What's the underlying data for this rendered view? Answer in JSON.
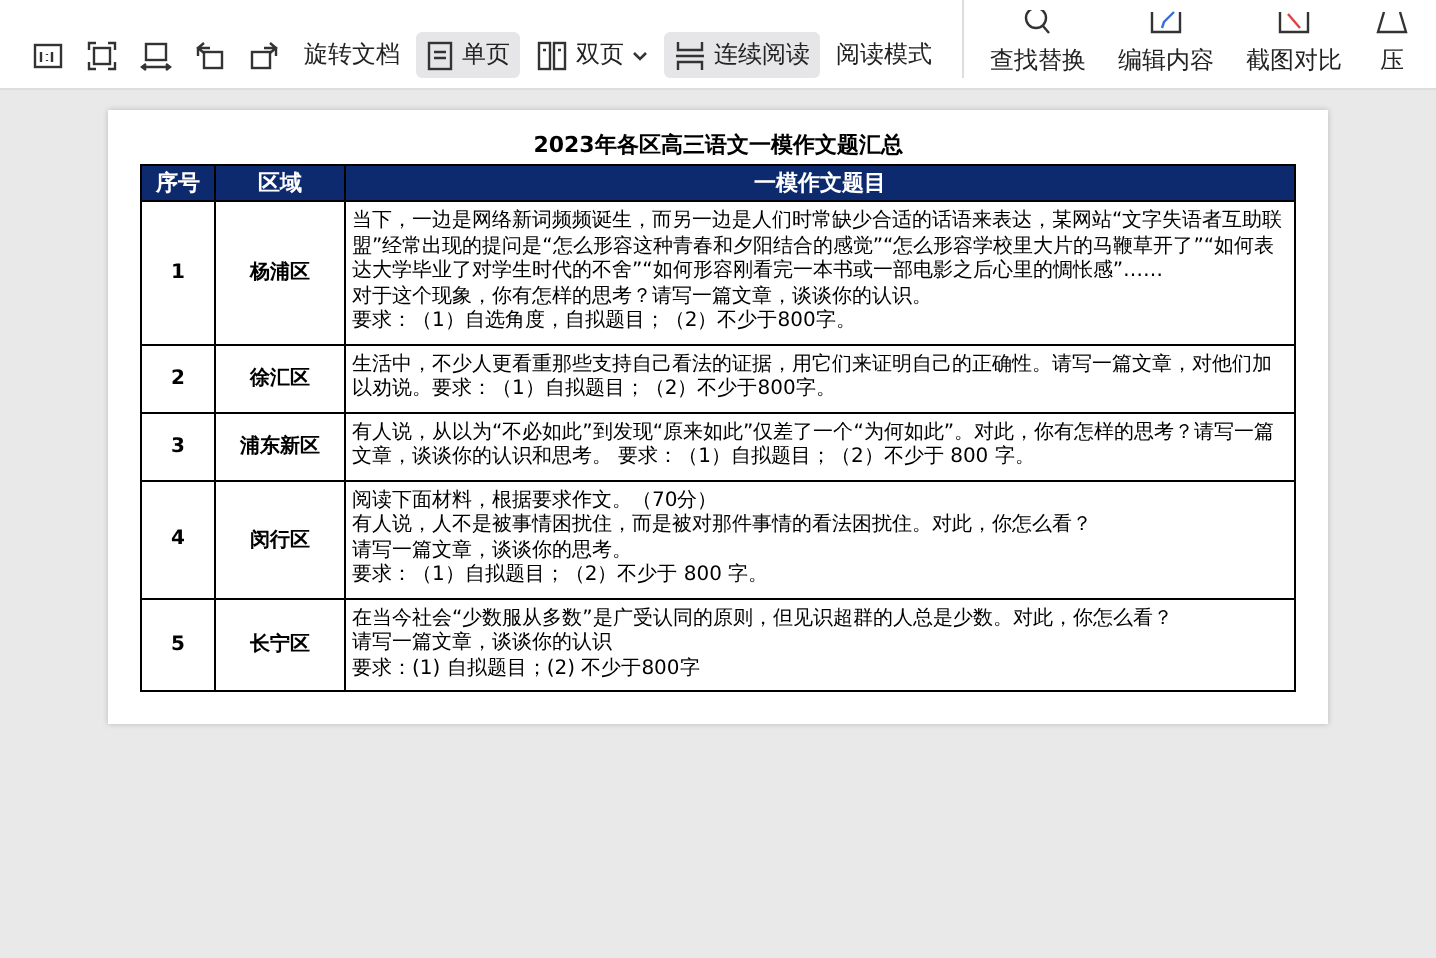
{
  "toolbar": {
    "view_buttons": [
      {
        "label": "旋转文档",
        "selected": false,
        "dropdown": false
      },
      {
        "label": "单页",
        "selected": true,
        "dropdown": false
      },
      {
        "label": "双页",
        "selected": false,
        "dropdown": true
      },
      {
        "label": "连续阅读",
        "selected": true,
        "dropdown": false
      },
      {
        "label": "阅读模式",
        "selected": false,
        "dropdown": false
      }
    ],
    "tools": [
      "查找替换",
      "编辑内容",
      "截图对比",
      "压"
    ]
  },
  "document": {
    "title": "2023年各区高三语文一模作文题汇总",
    "columns": [
      "序号",
      "区域",
      "一模作文题目"
    ],
    "rows": [
      {
        "number": "1",
        "district": "杨浦区",
        "prompt": [
          "当下，一边是网络新词频频诞生，而另一边是人们时常缺少合适的话语来表达，某网站“文字失语者互助联盟”经常出现的提问是“怎么形容这种青春和夕阳结合的感觉”“怎么形容学校里大片的马鞭草开了”“如何表达大学毕业了对学生时代的不舍”“如何形容刚看完一本书或一部电影之后心里的惆怅感”……",
          "对于这个现象，你有怎样的思考？请写一篇文章，谈谈你的认识。",
          "要求：（1）自选角度，自拟题目；（2）不少于800字。"
        ]
      },
      {
        "number": "2",
        "district": "徐汇区",
        "prompt": [
          "生活中，不少人更看重那些支持自己看法的证据，用它们来证明自己的正确性。请写一篇文章，对他们加以劝说。要求：（1）自拟题目；（2）不少于800字。"
        ]
      },
      {
        "number": "3",
        "district": "浦东新区",
        "prompt": [
          "有人说，从以为“不必如此”到发现“原来如此”仅差了一个“为何如此”。对此，你有怎样的思考？请写一篇文章，谈谈你的认识和思考。 要求：（1）自拟题目；（2）不少于 800 字。"
        ]
      },
      {
        "number": "4",
        "district": "闵行区",
        "prompt": [
          "阅读下面材料，根据要求作文。（70分）",
          "有人说，人不是被事情困扰住，而是被对那件事情的看法困扰住。对此，你怎么看？",
          "请写一篇文章，谈谈你的思考。",
          "要求：（1）自拟题目；（2）不少于 800 字。"
        ]
      },
      {
        "number": "5",
        "district": "长宁区",
        "prompt": [
          "在当今社会“少数服从多数”是广受认同的原则，但见识超群的人总是少数。对此，你怎么看？",
          "请写一篇文章，谈谈你的认识",
          "要求：(1) 自拟题目；(2) 不少于800字"
        ]
      }
    ]
  }
}
